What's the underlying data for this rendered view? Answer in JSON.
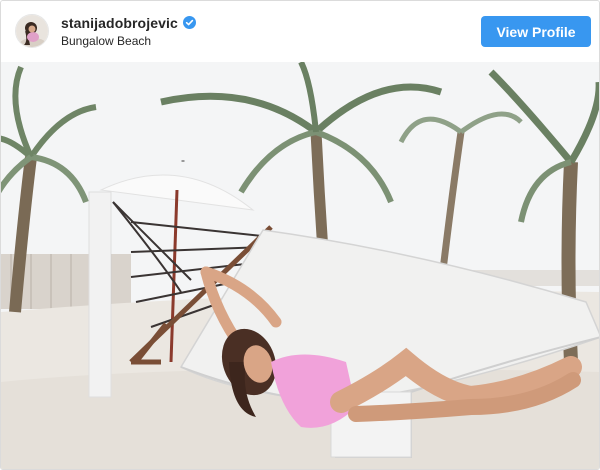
{
  "post": {
    "username": "stanijadobrojevic",
    "location": "Bungalow Beach",
    "verified": true,
    "view_profile_label": "View Profile"
  },
  "icons": {
    "avatar": "profile-avatar",
    "verified": "verified-badge-icon"
  },
  "colors": {
    "button": "#3897f0",
    "verified_badge": "#3897f0",
    "swimsuit": "#f2a6dc",
    "sand": "#ece8e2",
    "sky": "#f5f6f7"
  }
}
